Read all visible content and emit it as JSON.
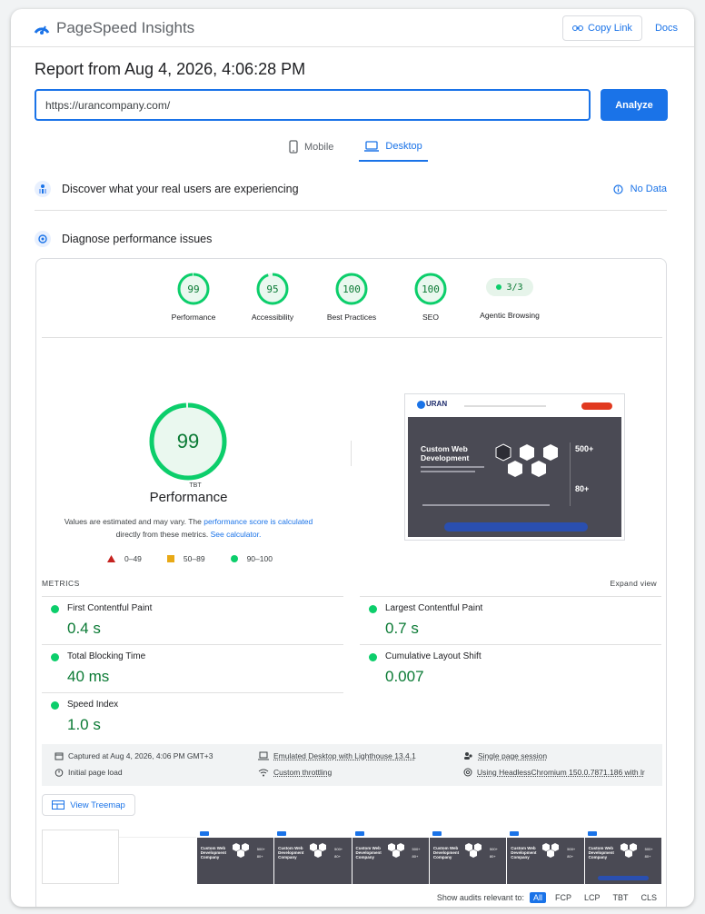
{
  "app": {
    "title": "PageSpeed Insights"
  },
  "topbar": {
    "copy_link": "Copy Link",
    "docs": "Docs"
  },
  "report": {
    "title": "Report from Aug 4, 2026, 4:06:28 PM",
    "url": "https://urancompany.com/",
    "analyze": "Analyze"
  },
  "tabs": [
    {
      "label": "Mobile",
      "icon": "smartphone-icon",
      "active": false
    },
    {
      "label": "Desktop",
      "icon": "laptop-icon",
      "active": true
    }
  ],
  "sections": {
    "discover": "Discover what your real users are experiencing",
    "no_data": "No Data",
    "diagnose": "Diagnose performance issues"
  },
  "gauges": [
    {
      "value": "99",
      "label": "Performance",
      "score": 0.99
    },
    {
      "value": "95",
      "label": "Accessibility",
      "score": 0.95
    },
    {
      "value": "100",
      "label": "Best Practices",
      "score": 1.0
    },
    {
      "value": "100",
      "label": "SEO",
      "score": 1.0
    }
  ],
  "agentic": {
    "value": "3/3",
    "label": "Agentic Browsing"
  },
  "performance": {
    "score": "99",
    "score_fraction": 0.99,
    "sub": "TBT",
    "title": "Performance",
    "note_prefix": "Values are estimated and may vary. The ",
    "note_link1": "performance score is calculated",
    "note_mid": " directly from these metrics. ",
    "note_link2": "See calculator."
  },
  "legend": [
    {
      "range": "0–49",
      "color": "#c5221f",
      "shape": "triangle"
    },
    {
      "range": "50–89",
      "color": "#e8a916",
      "shape": "square"
    },
    {
      "range": "90–100",
      "color": "#0cce6b",
      "shape": "circle"
    }
  ],
  "screenshot": {
    "brand": "URAN",
    "headline": "Custom Web Development",
    "stat1": "500+",
    "stat2": "80+"
  },
  "metrics": {
    "heading": "METRICS",
    "expand": "Expand view",
    "items": [
      {
        "label": "First Contentful Paint",
        "value": "0.4 s"
      },
      {
        "label": "Largest Contentful Paint",
        "value": "0.7 s"
      },
      {
        "label": "Total Blocking Time",
        "value": "40 ms"
      },
      {
        "label": "Cumulative Layout Shift",
        "value": "0.007"
      },
      {
        "label": "Speed Index",
        "value": "1.0 s"
      }
    ]
  },
  "info": {
    "captured": "Captured at Aug 4, 2026, 4:06 PM GMT+3",
    "emulated": "Emulated Desktop with Lighthouse 13.4.1",
    "session": "Single page session",
    "initial": "Initial page load",
    "throttling": "Custom throttling",
    "browser": "Using HeadlessChromium 150.0.7871.186 with lr"
  },
  "treemap": "View Treemap",
  "audits": {
    "label": "Show audits relevant to:",
    "chips": [
      "All",
      "FCP",
      "LCP",
      "TBT",
      "CLS"
    ]
  },
  "colors": {
    "accent": "#1a73e8",
    "pass": "#0cce6b",
    "pass_text": "#0a7a34"
  }
}
